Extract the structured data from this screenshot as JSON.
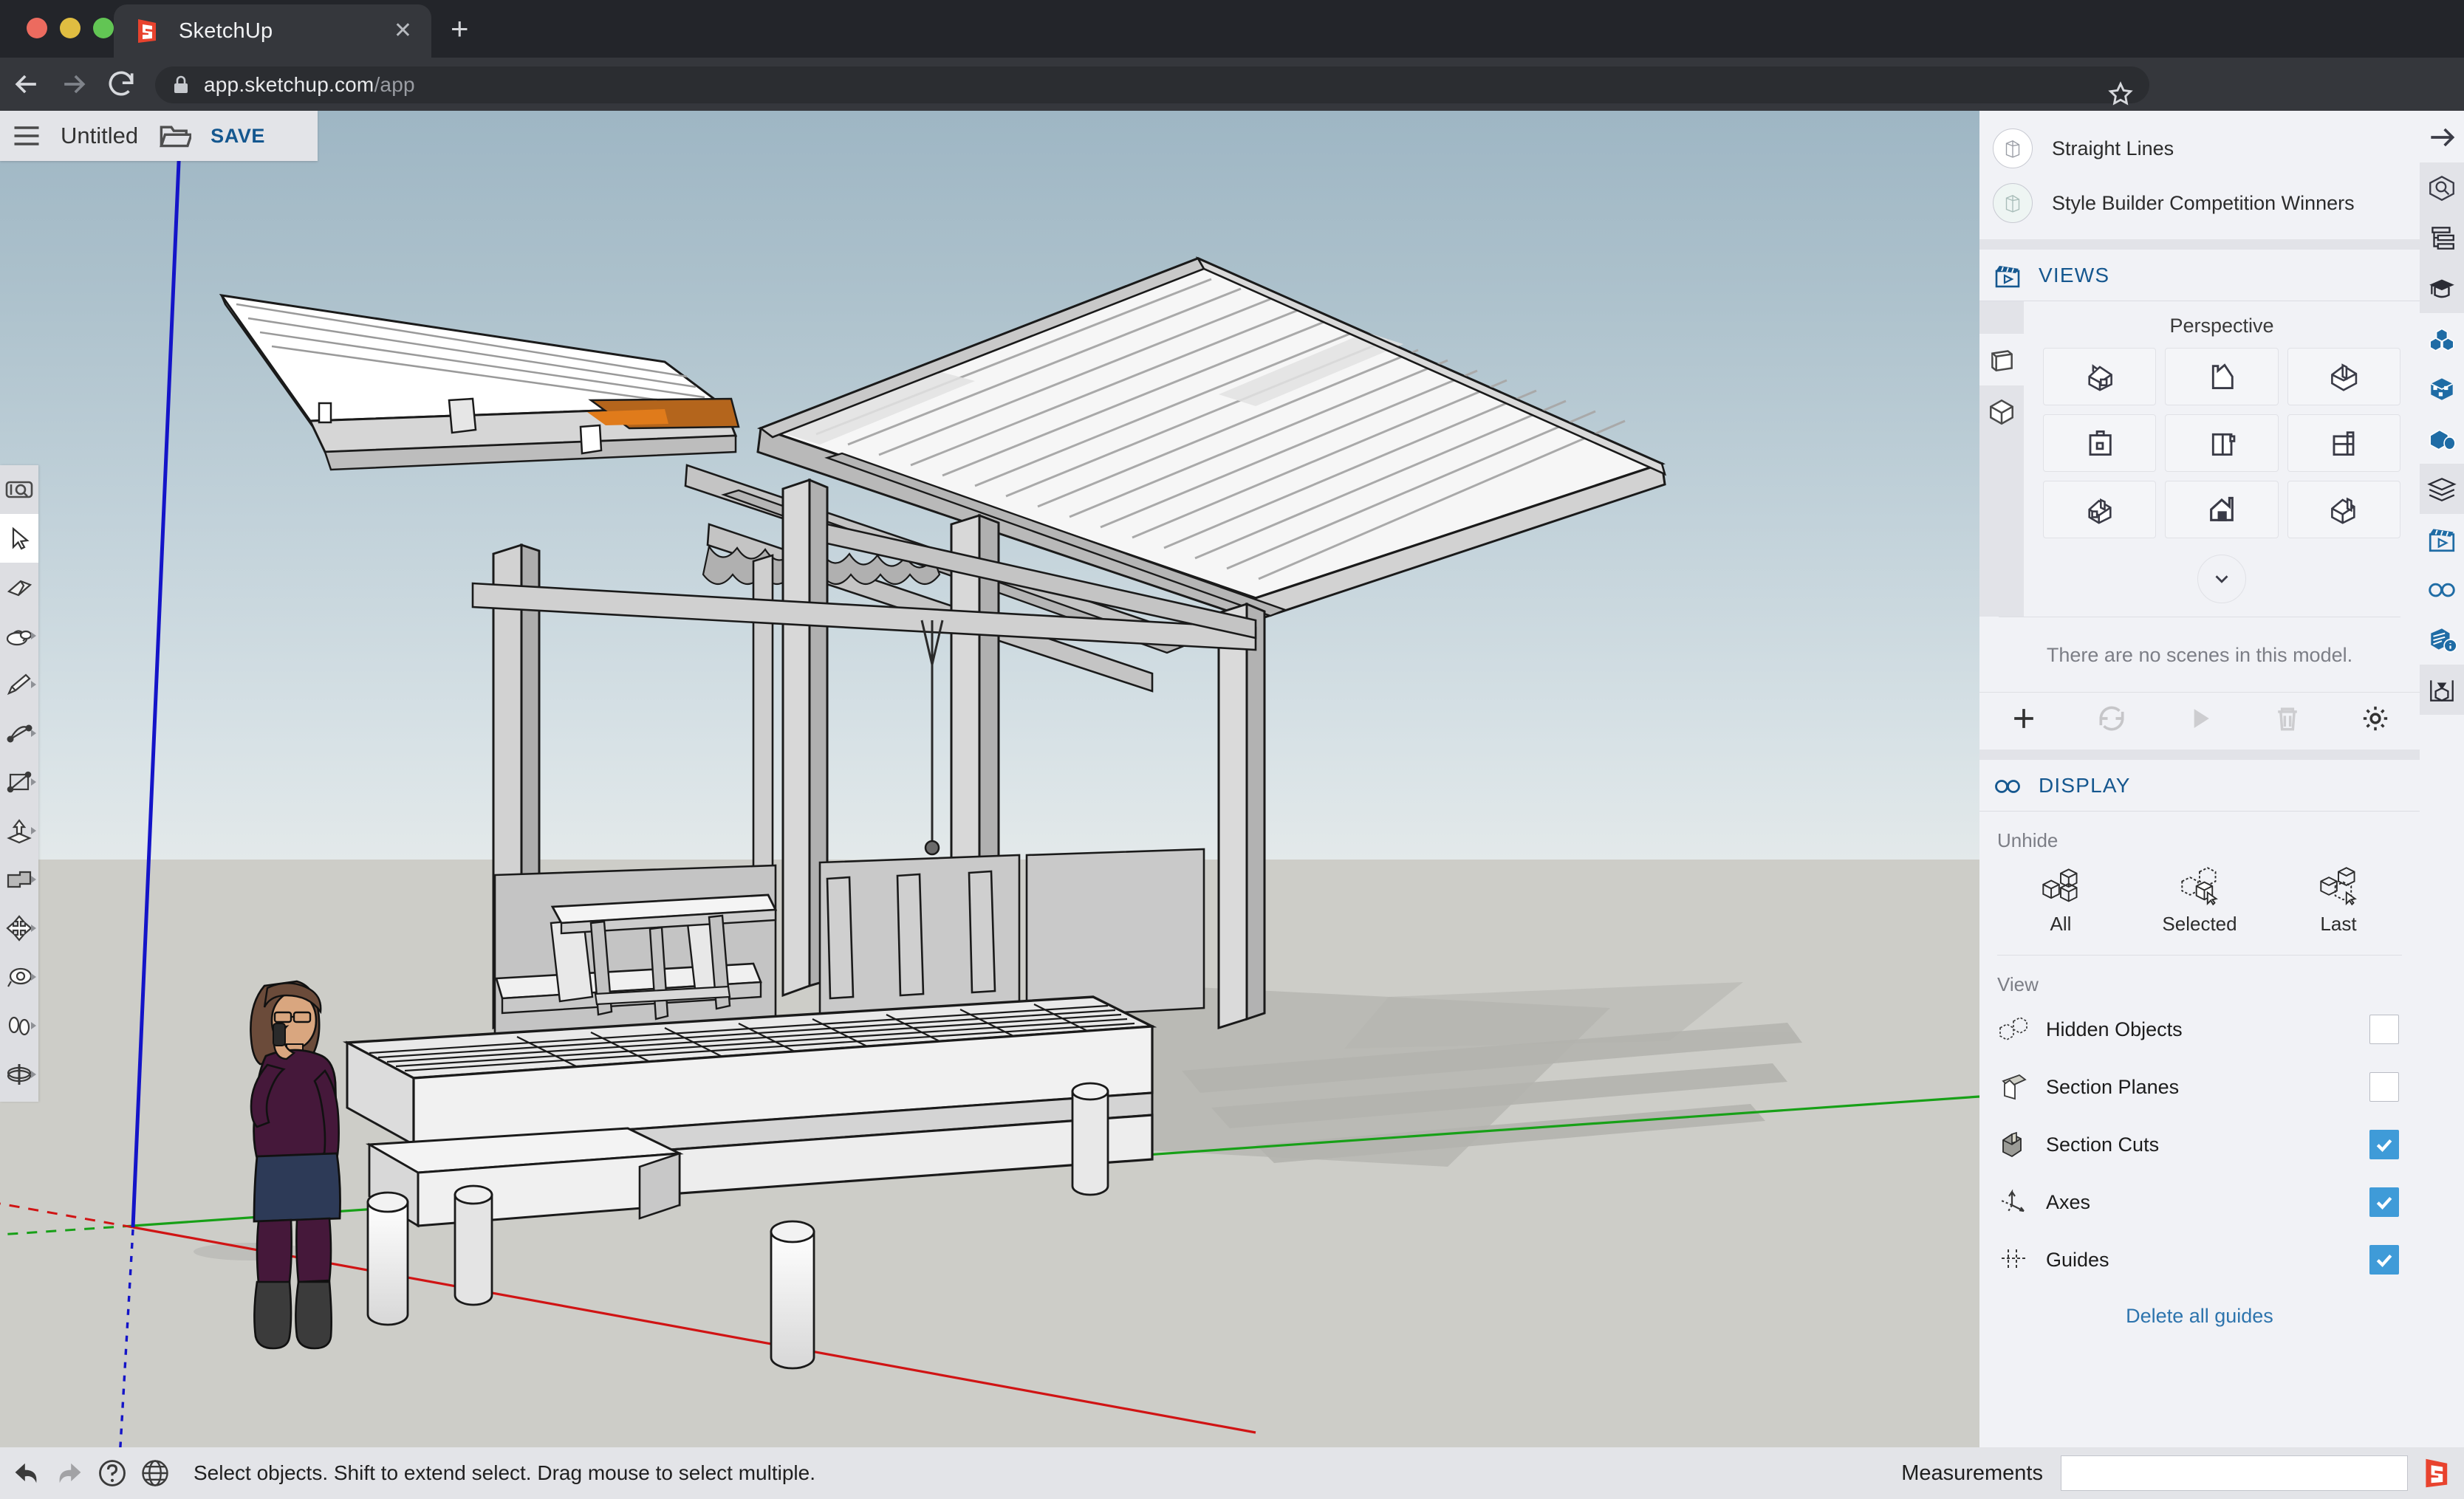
{
  "browser": {
    "tab_title": "SketchUp",
    "tab_favicon": "sketchup-logo-icon",
    "close_label": "✕",
    "new_tab_label": "+",
    "url_main": "app.sketchup.com",
    "url_path": "/app",
    "back_icon": "back-arrow-icon",
    "forward_icon": "forward-arrow-icon",
    "reload_icon": "reload-icon",
    "lock_icon": "lock-icon",
    "bookmark_icon": "star-icon"
  },
  "app_header": {
    "menu_icon": "hamburger-menu-icon",
    "title": "Untitled",
    "folder_icon": "folder-open-icon",
    "save_label": "SAVE"
  },
  "left_toolbar": {
    "items": [
      {
        "name": "search-tools",
        "icon": "search-box-icon",
        "active": false,
        "submenu": false
      },
      {
        "name": "select",
        "icon": "cursor-arrow-icon",
        "active": true,
        "submenu": false
      },
      {
        "name": "eraser",
        "icon": "eraser-icon",
        "active": false,
        "submenu": false
      },
      {
        "name": "paint-bucket",
        "icon": "paint-bucket-icon",
        "active": false,
        "submenu": true
      },
      {
        "name": "line",
        "icon": "pencil-icon",
        "active": false,
        "submenu": true
      },
      {
        "name": "arc",
        "icon": "arc-icon",
        "active": false,
        "submenu": true
      },
      {
        "name": "rectangle",
        "icon": "rectangle-icon",
        "active": false,
        "submenu": true
      },
      {
        "name": "push-pull",
        "icon": "push-pull-icon",
        "active": false,
        "submenu": true
      },
      {
        "name": "offset",
        "icon": "offset-icon",
        "active": false,
        "submenu": true
      },
      {
        "name": "move",
        "icon": "move-icon",
        "active": false,
        "submenu": true
      },
      {
        "name": "tape-measure",
        "icon": "tape-measure-icon",
        "active": false,
        "submenu": true
      },
      {
        "name": "walk",
        "icon": "walk-footprints-icon",
        "active": false,
        "submenu": true
      },
      {
        "name": "orbit",
        "icon": "orbit-icon",
        "active": false,
        "submenu": true
      }
    ]
  },
  "right_panel": {
    "collapse_icon": "arrow-right-icon",
    "styles": [
      {
        "label": "Straight Lines",
        "thumb": "style-thumb-icon"
      },
      {
        "label": "Style Builder Competition Winners",
        "thumb": "style-thumb-icon"
      }
    ],
    "views": {
      "icon": "clapperboard-icon",
      "title": "VIEWS",
      "projection_label": "Perspective",
      "mode_tabs": [
        {
          "name": "parallel-projection",
          "icon": "flat-cube-icon",
          "active": true
        },
        {
          "name": "perspective",
          "icon": "iso-cube-icon",
          "active": false
        }
      ],
      "standard_views": [
        {
          "name": "iso",
          "icon": "iso-view-icon"
        },
        {
          "name": "top",
          "icon": "top-view-icon"
        },
        {
          "name": "iso-back",
          "icon": "iso-back-view-icon"
        },
        {
          "name": "front",
          "icon": "front-view-icon"
        },
        {
          "name": "right",
          "icon": "right-view-icon"
        },
        {
          "name": "back",
          "icon": "back-view-icon"
        },
        {
          "name": "iso-left",
          "icon": "iso-left-view-icon"
        },
        {
          "name": "left",
          "icon": "left-view-icon"
        },
        {
          "name": "iso-right",
          "icon": "iso-right-view-icon"
        }
      ],
      "expand_icon": "chevron-down-icon",
      "empty_message": "There are no scenes in this model.",
      "actions": [
        {
          "name": "add-scene",
          "icon": "plus-icon",
          "enabled": true
        },
        {
          "name": "update-scene",
          "icon": "refresh-icon",
          "enabled": false
        },
        {
          "name": "play-scenes",
          "icon": "play-icon",
          "enabled": false
        },
        {
          "name": "delete-scene",
          "icon": "trash-icon",
          "enabled": false
        },
        {
          "name": "scene-settings",
          "icon": "gear-icon",
          "enabled": true
        }
      ]
    },
    "display": {
      "icon": "glasses-icon",
      "title": "DISPLAY",
      "unhide_label": "Unhide",
      "unhide_buttons": [
        {
          "label": "All",
          "icon": "cubes-all-icon"
        },
        {
          "label": "Selected",
          "icon": "cubes-selected-icon"
        },
        {
          "label": "Last",
          "icon": "cubes-last-icon"
        }
      ],
      "view_label": "View",
      "view_items": [
        {
          "label": "Hidden Objects",
          "icon": "hidden-objects-icon",
          "checked": false
        },
        {
          "label": "Section Planes",
          "icon": "section-planes-icon",
          "checked": false
        },
        {
          "label": "Section Cuts",
          "icon": "section-cuts-icon",
          "checked": true
        },
        {
          "label": "Axes",
          "icon": "axes-icon",
          "checked": true
        },
        {
          "label": "Guides",
          "icon": "guides-icon",
          "checked": true
        }
      ],
      "delete_guides_label": "Delete all guides"
    }
  },
  "right_rail": {
    "items": [
      {
        "name": "search-model",
        "icon": "model-search-icon",
        "shaded": true
      },
      {
        "name": "outliner",
        "icon": "outliner-icon",
        "shaded": true
      },
      {
        "name": "instructor",
        "icon": "graduation-cap-icon",
        "shaded": true
      },
      {
        "name": "components",
        "icon": "components-cubes-icon",
        "shaded": false
      },
      {
        "name": "materials",
        "icon": "materials-box-icon",
        "shaded": false
      },
      {
        "name": "entity-info",
        "icon": "entity-info-icon",
        "shaded": false
      },
      {
        "name": "layers",
        "icon": "layers-stack-icon",
        "shaded": true
      },
      {
        "name": "scenes",
        "icon": "clapperboard-icon",
        "shaded": false
      },
      {
        "name": "display",
        "icon": "glasses-icon",
        "shaded": false
      },
      {
        "name": "model-info",
        "icon": "model-info-icon",
        "shaded": false
      },
      {
        "name": "export",
        "icon": "export-box-icon",
        "shaded": true
      }
    ]
  },
  "status_bar": {
    "undo_icon": "undo-arrow-icon",
    "redo_icon": "redo-arrow-icon",
    "help_icon": "question-mark-icon",
    "globe_icon": "globe-icon",
    "message": "Select objects. Shift to extend select. Drag mouse to select multiple.",
    "measurements_label": "Measurements",
    "measurements_value": "",
    "logo_icon": "sketchup-logo-icon"
  },
  "viewport": {
    "name": "3d-model-canvas",
    "sky_top_color": "#9eb6c4",
    "sky_bottom_color": "#e3e9ea",
    "ground_color": "#cdcdc8",
    "axis_red": "#d01414",
    "axis_green": "#17a017",
    "axis_blue": "#1414c8",
    "model_description": "Timber pavilion with corrugated butterfly roof, deck platform, benches, table and scale figure"
  }
}
